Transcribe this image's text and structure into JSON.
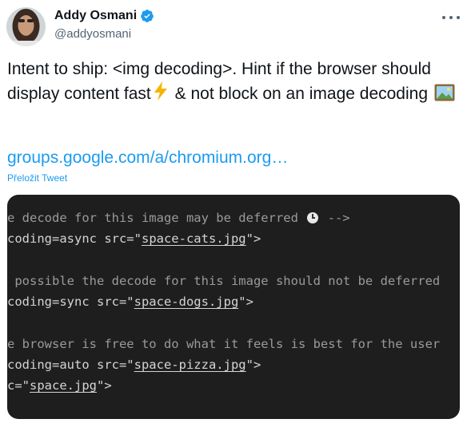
{
  "author": {
    "name": "Addy Osmani",
    "handle": "@addyosmani"
  },
  "tweet": {
    "text_part1": "Intent to ship: <img decoding>. Hint if the browser should display content fast",
    "text_part2": " & not block on an image decoding ",
    "link": "groups.google.com/a/chromium.org…",
    "translate": "Přeložit Tweet"
  },
  "code": {
    "line1_comment": "e decode for this image may be deferred ",
    "line1_end": " -->",
    "line2_pre": "coding=async src=\"",
    "line2_file": "space-cats.jpg",
    "line2_post": "\">",
    "line3_comment": " possible the decode for this image should not be deferred",
    "line4_pre": "coding=sync src=\"",
    "line4_file": "space-dogs.jpg",
    "line4_post": "\">",
    "line5_comment": "e browser is free to do what it feels is best for the user",
    "line6_pre": "coding=auto src=\"",
    "line6_file": "space-pizza.jpg",
    "line6_post": "\">",
    "line7_pre": "c=\"",
    "line7_file": "space.jpg",
    "line7_post": "\">"
  },
  "colors": {
    "accent": "#1d9bf0",
    "code_bg": "#1e1e1e"
  }
}
